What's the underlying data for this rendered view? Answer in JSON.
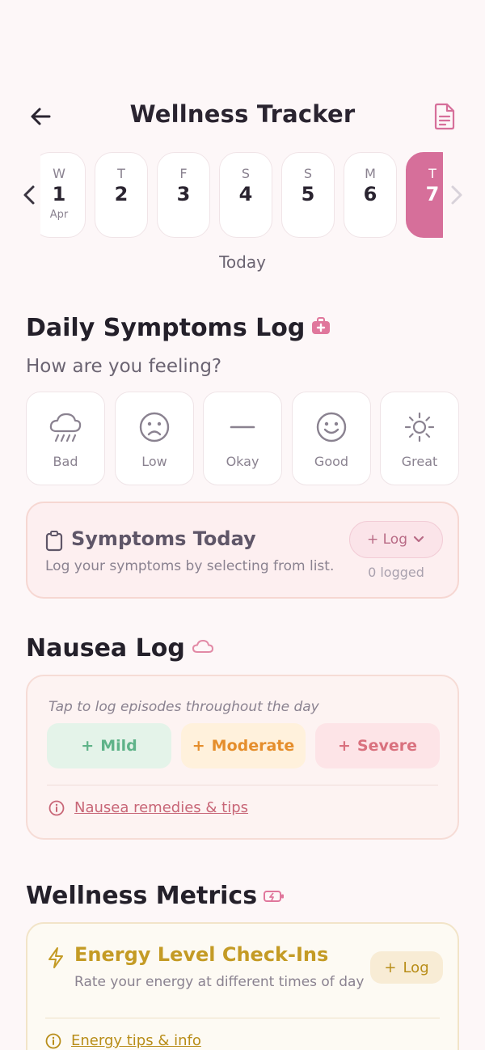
{
  "header": {
    "title": "Wellness Tracker",
    "back_icon": "arrow-left-icon",
    "report_icon": "document-icon"
  },
  "date_strip": {
    "days": [
      {
        "dow": "W",
        "num": "1",
        "month": "Apr",
        "active": false
      },
      {
        "dow": "T",
        "num": "2",
        "month": "",
        "active": false
      },
      {
        "dow": "F",
        "num": "3",
        "month": "",
        "active": false
      },
      {
        "dow": "S",
        "num": "4",
        "month": "",
        "active": false
      },
      {
        "dow": "S",
        "num": "5",
        "month": "",
        "active": false
      },
      {
        "dow": "M",
        "num": "6",
        "month": "",
        "active": false
      },
      {
        "dow": "T",
        "num": "7",
        "month": "",
        "active": true
      }
    ],
    "selected_label": "Today",
    "accent_color": "#d66f9a"
  },
  "symptoms_section": {
    "title": "Daily Symptoms Log",
    "question": "How are you feeling?",
    "moods": [
      {
        "label": "Bad",
        "icon": "rain-cloud-icon"
      },
      {
        "label": "Low",
        "icon": "sad-face-icon"
      },
      {
        "label": "Okay",
        "icon": "neutral-line-icon"
      },
      {
        "label": "Good",
        "icon": "happy-face-icon"
      },
      {
        "label": "Great",
        "icon": "sun-icon"
      }
    ],
    "card": {
      "title": "Symptoms Today",
      "subtitle": "Log your symptoms by selecting from list.",
      "log_button": "+ Log",
      "logged_count": "0 logged"
    }
  },
  "nausea_section": {
    "title": "Nausea Log",
    "hint": "Tap to log episodes throughout the day",
    "buttons": {
      "mild": "Mild",
      "moderate": "Moderate",
      "severe": "Severe"
    },
    "tips_link": "Nausea remedies & tips"
  },
  "metrics_section": {
    "title": "Wellness Metrics",
    "energy": {
      "title": "Energy Level Check-Ins",
      "subtitle": "Rate your energy at different times of day",
      "log_button": "Log",
      "tips_link": "Energy tips & info"
    }
  }
}
